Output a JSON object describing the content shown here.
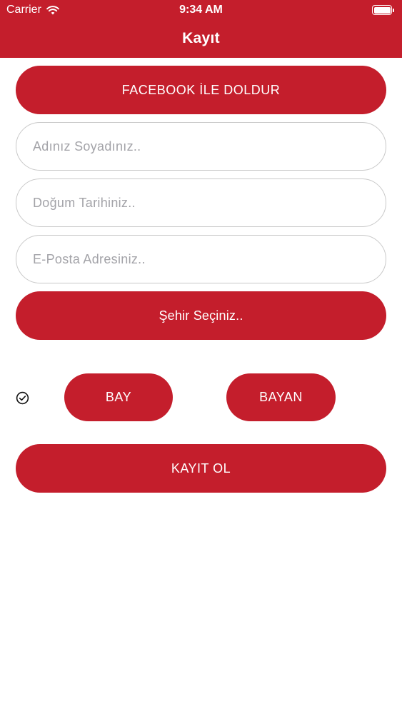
{
  "status_bar": {
    "carrier": "Carrier",
    "time": "9:34 AM",
    "battery_level": 1.0,
    "icons": [
      "wifi-icon",
      "battery-icon"
    ]
  },
  "nav": {
    "title": "Kayıt"
  },
  "buttons": {
    "facebook": "FACEBOOK İLE DOLDUR",
    "city": "Şehir Seçiniz..",
    "male": "BAY",
    "female": "BAYAN",
    "register": "KAYIT OL"
  },
  "fields": {
    "name_placeholder": "Adınız Soyadınız..",
    "birthdate_placeholder": "Doğum Tarihiniz..",
    "email_placeholder": "E-Posta Adresiniz.."
  },
  "gender_selector": {
    "icon": "check-circle-icon"
  },
  "colors": {
    "primary": "#C41E2C",
    "on_primary": "#FFFFFF",
    "field_border": "#C9C9C9",
    "placeholder": "#A3A3A8"
  }
}
